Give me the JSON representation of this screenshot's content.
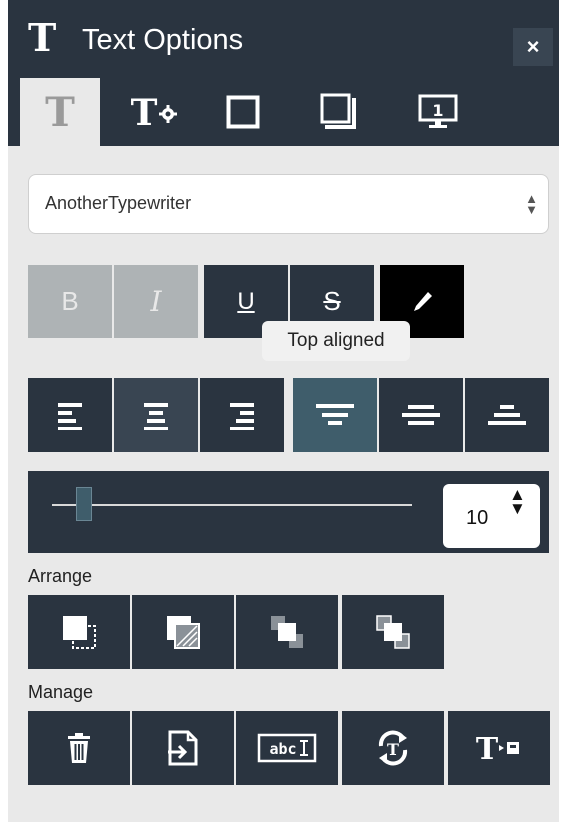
{
  "header": {
    "icon": "text-T-icon",
    "title": "Text Options",
    "close_label": "×"
  },
  "tabs": [
    {
      "name": "text-tab",
      "icon": "text-T-icon",
      "active": true
    },
    {
      "name": "text-settings-tab",
      "icon": "text-gear-icon",
      "active": false
    },
    {
      "name": "border-tab",
      "icon": "square-outline-icon",
      "active": false
    },
    {
      "name": "shadow-tab",
      "icon": "shadow-square-icon",
      "active": false
    },
    {
      "name": "display-tab",
      "icon": "monitor-1-icon",
      "active": false
    }
  ],
  "font": {
    "selected": "AnotherTypewriter"
  },
  "format_buttons": {
    "bold": "B",
    "italic": "I",
    "underline": "U",
    "strikethrough": "S",
    "color_icon": "eyedropper-icon",
    "text_color": "#ffffff"
  },
  "tooltip": "Top aligned",
  "alignment": {
    "horizontal": [
      "align-left",
      "align-center",
      "align-right"
    ],
    "vertical": [
      "align-top",
      "align-middle",
      "align-bottom"
    ],
    "selected_vertical": "align-top"
  },
  "size": {
    "value": "10",
    "slider_fraction": 0.09
  },
  "arrange": {
    "label": "Arrange",
    "buttons": [
      "bring-to-front-icon",
      "send-to-back-icon",
      "bring-forward-icon",
      "send-backward-icon"
    ]
  },
  "manage": {
    "label": "Manage",
    "buttons": [
      "trash-icon",
      "export-icon",
      "text-field-icon",
      "rotate-text-icon",
      "text-to-image-icon"
    ]
  },
  "colors": {
    "dark": "#2a3440",
    "selected": "#3f5d6b",
    "disabled": "#aeb3b5",
    "panel_bg": "#e9e9e9"
  }
}
